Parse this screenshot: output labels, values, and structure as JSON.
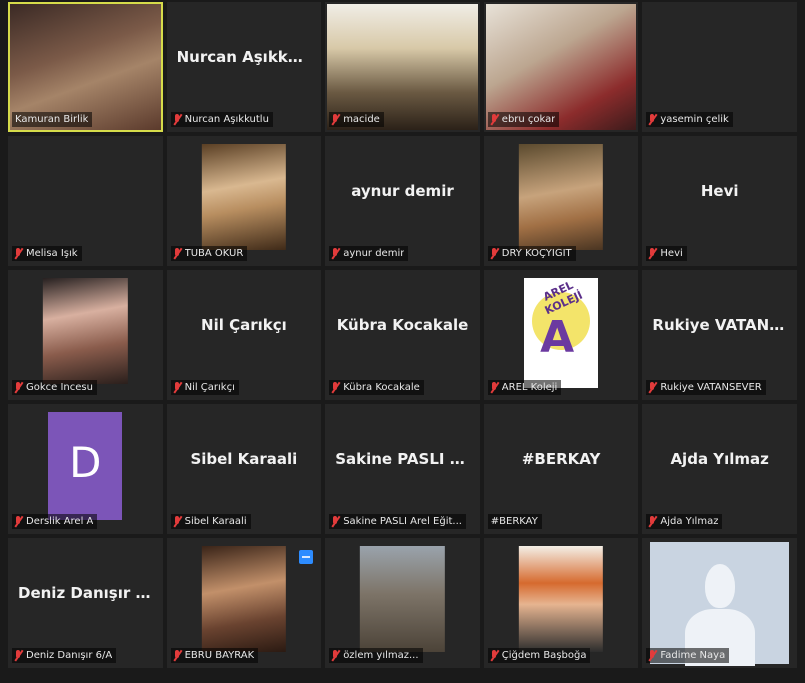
{
  "participants": [
    {
      "name": "Kamuran Birlik",
      "tag": "Kamuran Birlik",
      "mode": "video",
      "muted": false,
      "active": true
    },
    {
      "name": "Nurcan Aşıkkutlu",
      "tag": "Nurcan Aşıkkutlu",
      "mode": "name",
      "muted": true
    },
    {
      "name": "macide",
      "tag": "macide",
      "mode": "video",
      "muted": true
    },
    {
      "name": "ebru çokar",
      "tag": "ebru çokar",
      "mode": "video",
      "muted": true
    },
    {
      "name": "yasemin çelik",
      "tag": "yasemin çelik",
      "mode": "blank",
      "muted": true
    },
    {
      "name": "Melisa Işık",
      "tag": "Melisa Işık",
      "mode": "blank",
      "muted": true
    },
    {
      "name": "TUBA OKUR",
      "tag": "TUBA OKUR",
      "mode": "thumb",
      "muted": true
    },
    {
      "name": "aynur demir",
      "tag": "aynur demir",
      "mode": "name",
      "muted": true
    },
    {
      "name": "DRY KOÇYİĞİT",
      "tag": "DRY KOÇYİĞİT",
      "mode": "thumb",
      "muted": true
    },
    {
      "name": "Hevi",
      "tag": "Hevi",
      "mode": "name",
      "muted": true
    },
    {
      "name": "Gokce Incesu",
      "tag": "Gokce Incesu",
      "mode": "thumb",
      "muted": true
    },
    {
      "name": "Nil Çarıkçı",
      "tag": "Nil Çarıkçı",
      "mode": "name",
      "muted": true
    },
    {
      "name": "Kübra Kocakale",
      "tag": "Kübra Kocakale",
      "mode": "name",
      "muted": true
    },
    {
      "name": "AREL Koleji",
      "tag": "AREL Koleji",
      "mode": "logo",
      "logo_text": "AREL KOLEJİ",
      "muted": true
    },
    {
      "name": "Rukiye VATANS...",
      "tag": "Rukiye VATANSEVER",
      "mode": "name",
      "muted": true
    },
    {
      "name": "Derslik Arel A",
      "tag": "Derslik Arel A",
      "mode": "avatar",
      "initial": "D",
      "muted": true
    },
    {
      "name": "Sibel Karaali",
      "tag": "Sibel Karaali",
      "mode": "name",
      "muted": true
    },
    {
      "name": "Sakine PASLI Ar...",
      "tag": "Sakine PASLI Arel Eğit...",
      "mode": "name",
      "muted": true
    },
    {
      "name": "#BERKAY",
      "tag": "#BERKAY",
      "mode": "name",
      "muted": false
    },
    {
      "name": "Ajda Yılmaz",
      "tag": "Ajda Yılmaz",
      "mode": "name",
      "muted": true
    },
    {
      "name": "Deniz Danışır 6/A",
      "tag": "Deniz Danışır 6/A",
      "mode": "name",
      "muted": true
    },
    {
      "name": "EBRU BAYRAK",
      "tag": "EBRU BAYRAK",
      "mode": "thumb",
      "muted": true,
      "share_badge": true
    },
    {
      "name": "özlem yılmaz",
      "tag": "özlem yılmaz...",
      "mode": "thumb",
      "muted": true
    },
    {
      "name": "Çiğdem Başboğa",
      "tag": "Çiğdem Başboğa",
      "mode": "thumb",
      "muted": true
    },
    {
      "name": "Fadime Naya",
      "tag": "Fadime Naya",
      "mode": "silhouette",
      "muted": true
    }
  ],
  "colors": {
    "active_border": "#d6dc4a",
    "mute_icon": "#e23b3b",
    "tile_bg": "#262626",
    "avatar_bg": "#7c55b8"
  },
  "icons": {
    "muted": "mic-muted-icon",
    "share": "share-screen-icon"
  }
}
